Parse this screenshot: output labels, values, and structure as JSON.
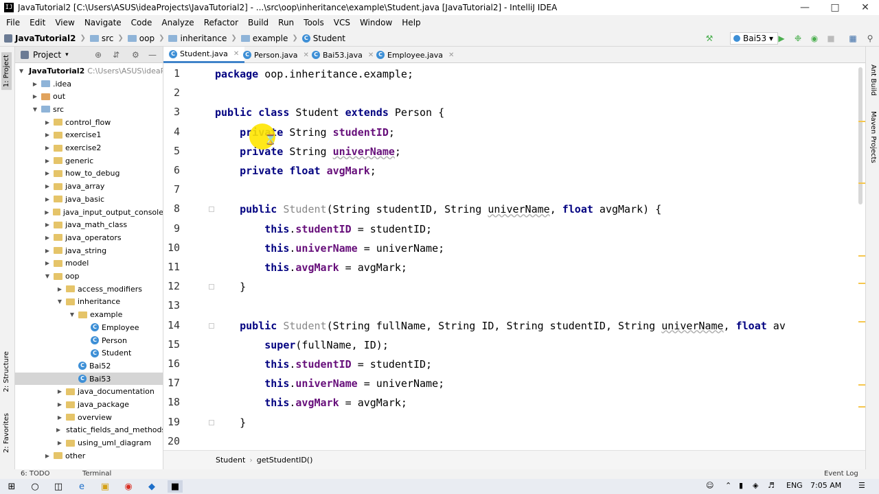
{
  "window": {
    "title": "JavaTutorial2 [C:\\Users\\ASUS\\ideaProjects\\JavaTutorial2] - ...\\src\\oop\\inheritance\\example\\Student.java [JavaTutorial2] - IntelliJ IDEA",
    "app_icon_text": "IJ",
    "controls": [
      "minimize-icon",
      "maximize-icon",
      "close-icon"
    ]
  },
  "menu": [
    "File",
    "Edit",
    "View",
    "Navigate",
    "Code",
    "Analyze",
    "Refactor",
    "Build",
    "Run",
    "Tools",
    "VCS",
    "Window",
    "Help"
  ],
  "breadcrumbs": [
    "JavaTutorial2",
    "src",
    "oop",
    "inheritance",
    "example",
    "Student"
  ],
  "run_config": "Bai53",
  "tool_windows": {
    "left": [
      "1: Project",
      "2: Structure",
      "2: Favorites"
    ],
    "right": [
      "Ant Build",
      "Maven Projects"
    ]
  },
  "project_panel": {
    "title": "Project",
    "tree": [
      {
        "label": "JavaTutorial2",
        "hint": "C:\\Users\\ASUS\\ideaPr",
        "depth": 0,
        "expanded": true,
        "icon": "project-icon"
      },
      {
        "label": ".idea",
        "depth": 1,
        "expanded": false,
        "icon": "folder-icon"
      },
      {
        "label": "out",
        "depth": 1,
        "expanded": false,
        "icon": "folder-orange-icon",
        "selected": false
      },
      {
        "label": "src",
        "depth": 1,
        "expanded": true,
        "icon": "folder-icon"
      },
      {
        "label": "control_flow",
        "depth": 2,
        "expanded": false,
        "icon": "package-icon"
      },
      {
        "label": "exercise1",
        "depth": 2,
        "expanded": false,
        "icon": "package-icon"
      },
      {
        "label": "exercise2",
        "depth": 2,
        "expanded": false,
        "icon": "package-icon"
      },
      {
        "label": "generic",
        "depth": 2,
        "expanded": false,
        "icon": "package-icon"
      },
      {
        "label": "how_to_debug",
        "depth": 2,
        "expanded": false,
        "icon": "package-icon"
      },
      {
        "label": "java_array",
        "depth": 2,
        "expanded": false,
        "icon": "package-icon"
      },
      {
        "label": "java_basic",
        "depth": 2,
        "expanded": false,
        "icon": "package-icon"
      },
      {
        "label": "java_input_output_console",
        "depth": 2,
        "expanded": false,
        "icon": "package-icon"
      },
      {
        "label": "java_math_class",
        "depth": 2,
        "expanded": false,
        "icon": "package-icon"
      },
      {
        "label": "java_operators",
        "depth": 2,
        "expanded": false,
        "icon": "package-icon"
      },
      {
        "label": "java_string",
        "depth": 2,
        "expanded": false,
        "icon": "package-icon"
      },
      {
        "label": "model",
        "depth": 2,
        "expanded": false,
        "icon": "package-icon"
      },
      {
        "label": "oop",
        "depth": 2,
        "expanded": true,
        "icon": "package-icon"
      },
      {
        "label": "access_modifiers",
        "depth": 3,
        "expanded": false,
        "icon": "package-icon"
      },
      {
        "label": "inheritance",
        "depth": 3,
        "expanded": true,
        "icon": "package-icon"
      },
      {
        "label": "example",
        "depth": 4,
        "expanded": true,
        "icon": "package-icon"
      },
      {
        "label": "Employee",
        "depth": 5,
        "icon": "class-icon"
      },
      {
        "label": "Person",
        "depth": 5,
        "icon": "class-icon"
      },
      {
        "label": "Student",
        "depth": 5,
        "icon": "class-icon"
      },
      {
        "label": "Bai52",
        "depth": 4,
        "icon": "class-icon"
      },
      {
        "label": "Bai53",
        "depth": 4,
        "icon": "class-icon",
        "selected": true
      },
      {
        "label": "java_documentation",
        "depth": 3,
        "expanded": false,
        "icon": "package-icon"
      },
      {
        "label": "java_package",
        "depth": 3,
        "expanded": false,
        "icon": "package-icon"
      },
      {
        "label": "overview",
        "depth": 3,
        "expanded": false,
        "icon": "package-icon"
      },
      {
        "label": "static_fields_and_methods",
        "depth": 3,
        "expanded": false,
        "icon": "package-icon"
      },
      {
        "label": "using_uml_diagram",
        "depth": 3,
        "expanded": false,
        "icon": "package-icon"
      },
      {
        "label": "other",
        "depth": 2,
        "expanded": false,
        "icon": "package-icon"
      }
    ]
  },
  "tabs": [
    {
      "label": "Student.java",
      "active": true
    },
    {
      "label": "Person.java",
      "active": false
    },
    {
      "label": "Bai53.java",
      "active": false
    },
    {
      "label": "Employee.java",
      "active": false
    }
  ],
  "code": {
    "lines": [
      {
        "n": "1",
        "html": "<span class=\"kw\">package</span> oop.inheritance.example;"
      },
      {
        "n": "2",
        "html": ""
      },
      {
        "n": "3",
        "html": "<span class=\"kw\">public class</span> Student <span class=\"kw\">extends</span> Person {"
      },
      {
        "n": "4",
        "html": "    <span class=\"kw\">private</span> String <span class=\"fld\">studentID</span>;"
      },
      {
        "n": "5",
        "html": "    <span class=\"kw\">private</span> String <span class=\"fld squig\">univerName</span>;"
      },
      {
        "n": "6",
        "html": "    <span class=\"kw\">private float</span> <span class=\"fld\">avgMark</span>;"
      },
      {
        "n": "7",
        "html": ""
      },
      {
        "n": "8",
        "html": "    <span class=\"kw\">public</span> <span class=\"ctor\">Student</span>(String studentID, String <span class=\"squig\">univerName</span>, <span class=\"kw\">float</span> avgMark) {"
      },
      {
        "n": "9",
        "html": "        <span class=\"kw\">this</span>.<span class=\"fld\">studentID</span> = studentID;"
      },
      {
        "n": "10",
        "html": "        <span class=\"kw\">this</span>.<span class=\"fld\">univerName</span> = univerName;"
      },
      {
        "n": "11",
        "html": "        <span class=\"kw\">this</span>.<span class=\"fld\">avgMark</span> = avgMark;"
      },
      {
        "n": "12",
        "html": "    }"
      },
      {
        "n": "13",
        "html": ""
      },
      {
        "n": "14",
        "html": "    <span class=\"kw\">public</span> <span class=\"ctor\">Student</span>(String fullName, String ID, String studentID, String <span class=\"squig\">univerName</span>, <span class=\"kw\">float</span> av"
      },
      {
        "n": "15",
        "html": "        <span class=\"kw\">super</span>(fullName, ID);"
      },
      {
        "n": "16",
        "html": "        <span class=\"kw\">this</span>.<span class=\"fld\">studentID</span> = studentID;"
      },
      {
        "n": "17",
        "html": "        <span class=\"kw\">this</span>.<span class=\"fld\">univerName</span> = univerName;"
      },
      {
        "n": "18",
        "html": "        <span class=\"kw\">this</span>.<span class=\"fld\">avgMark</span> = avgMark;"
      },
      {
        "n": "19",
        "html": "    }"
      },
      {
        "n": "20",
        "html": ""
      }
    ]
  },
  "editor_breadcrumb": [
    "Student",
    "getStudentID()"
  ],
  "bottom_bar": {
    "todo": "6: TODO",
    "terminal": "Terminal",
    "event_log": "Event Log"
  },
  "taskbar": {
    "language": "ENG",
    "time": "7:05 AM"
  }
}
